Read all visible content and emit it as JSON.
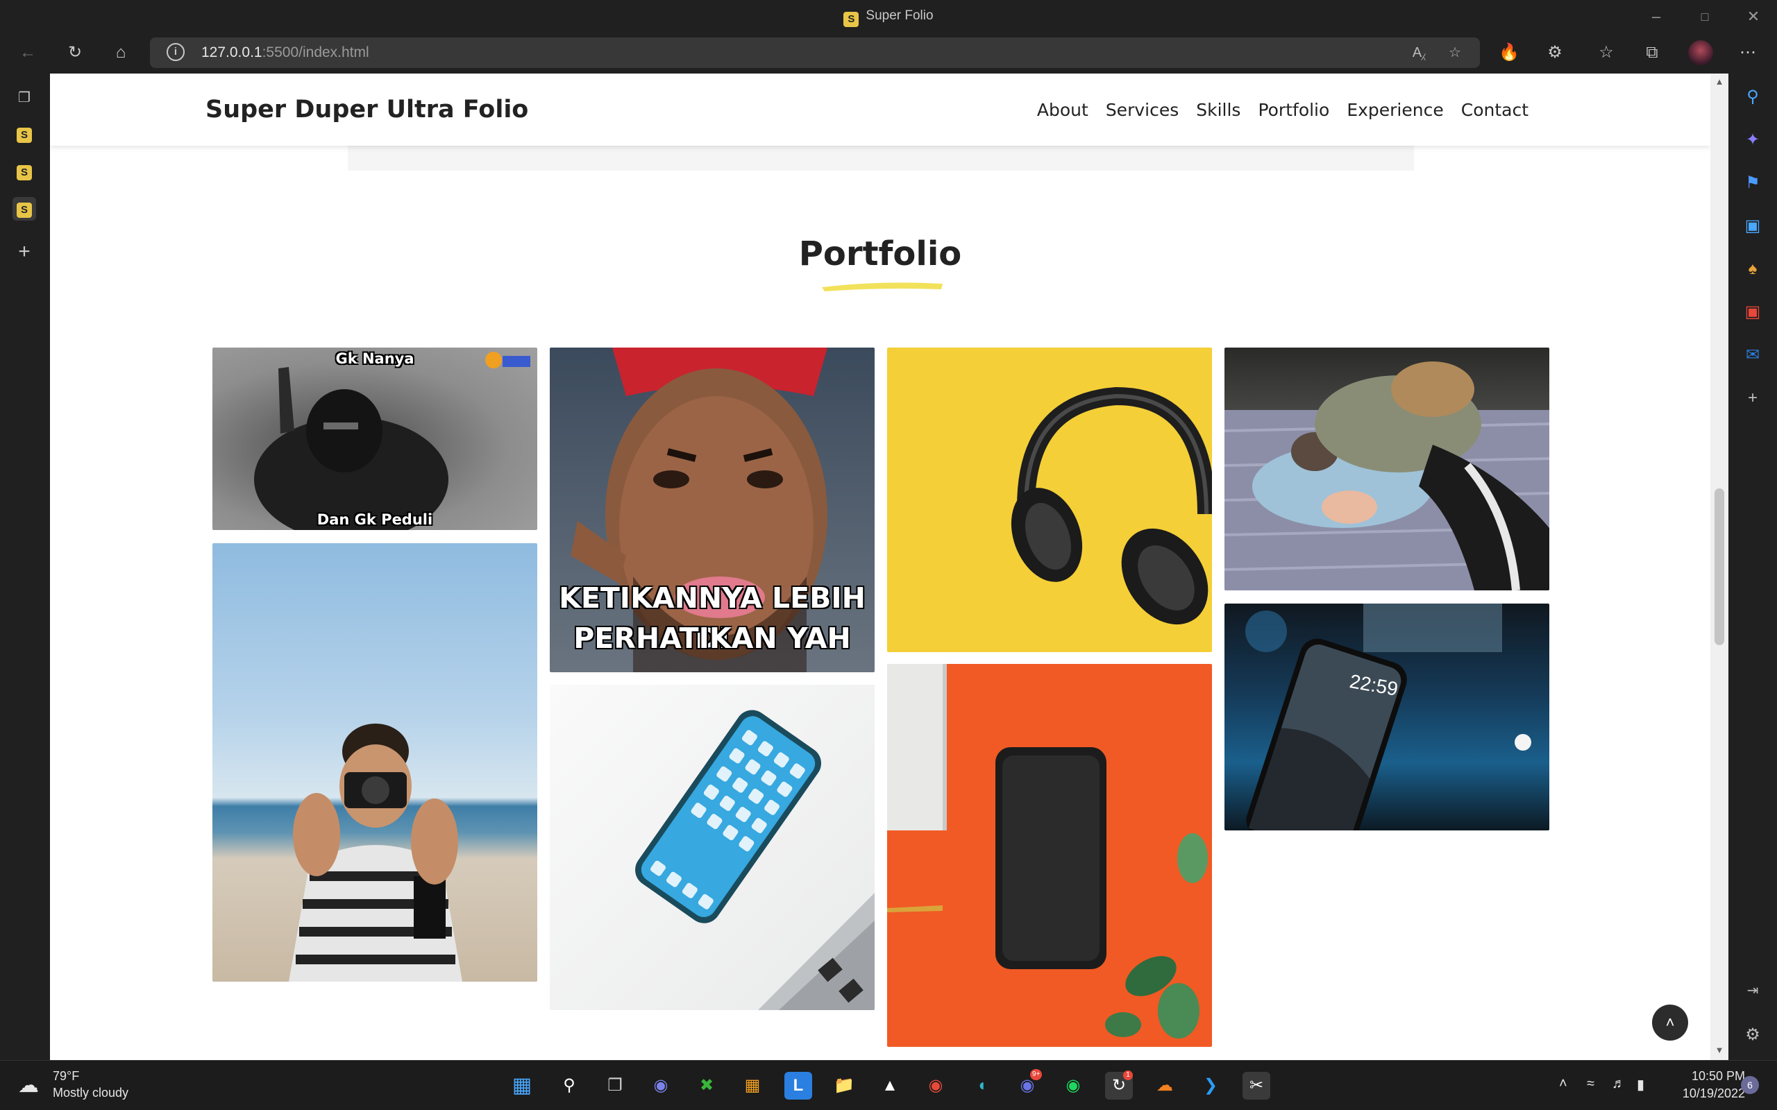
{
  "window": {
    "title": "Super Folio",
    "favicon": "S"
  },
  "toolbar": {
    "url_host": "127.0.0.1",
    "url_rest": ":5500/index.html",
    "icons": [
      "back-icon",
      "refresh-icon",
      "home-icon",
      "info-icon",
      "read-aloud-icon",
      "add-favorite-icon",
      "flame-extension-icon",
      "extensions-icon",
      "favorites-icon",
      "collections-icon",
      "profile-avatar",
      "more-menu-icon"
    ]
  },
  "vertical_tabs": {
    "tab_letter": "S",
    "new_tab": "+"
  },
  "site": {
    "brand": "Super Duper Ultra Folio",
    "nav": [
      "About",
      "Services",
      "Skills",
      "Portfolio",
      "Experience",
      "Contact"
    ],
    "section_title": "Portfolio",
    "accent": "#f2e15a",
    "gallery": {
      "meme1_top": "Gk Nanya",
      "meme1_bottom": "Dan Gk Peduli",
      "meme2_line1": "KETIKANNYA LEBIH DI",
      "meme2_line2": "PERHATIKAN YAH",
      "phone_time": "22:59"
    }
  },
  "taskbar": {
    "temperature": "79°F",
    "condition": "Mostly cloudy",
    "time": "10:50 PM",
    "date": "10/19/2022",
    "notifications": "6",
    "discord_badge": "9+",
    "sync_badge": "1"
  }
}
